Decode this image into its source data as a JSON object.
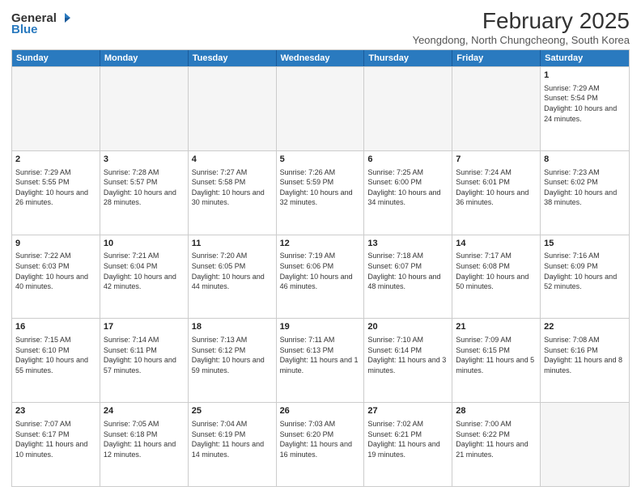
{
  "header": {
    "logo_general": "General",
    "logo_blue": "Blue",
    "month_title": "February 2025",
    "location": "Yeongdong, North Chungcheong, South Korea"
  },
  "days_of_week": [
    "Sunday",
    "Monday",
    "Tuesday",
    "Wednesday",
    "Thursday",
    "Friday",
    "Saturday"
  ],
  "weeks": [
    [
      {
        "day": "",
        "empty": true
      },
      {
        "day": "",
        "empty": true
      },
      {
        "day": "",
        "empty": true
      },
      {
        "day": "",
        "empty": true
      },
      {
        "day": "",
        "empty": true
      },
      {
        "day": "",
        "empty": true
      },
      {
        "day": "1",
        "sunrise": "7:29 AM",
        "sunset": "5:54 PM",
        "daylight": "10 hours and 24 minutes."
      }
    ],
    [
      {
        "day": "2",
        "sunrise": "7:29 AM",
        "sunset": "5:55 PM",
        "daylight": "10 hours and 26 minutes."
      },
      {
        "day": "3",
        "sunrise": "7:28 AM",
        "sunset": "5:57 PM",
        "daylight": "10 hours and 28 minutes."
      },
      {
        "day": "4",
        "sunrise": "7:27 AM",
        "sunset": "5:58 PM",
        "daylight": "10 hours and 30 minutes."
      },
      {
        "day": "5",
        "sunrise": "7:26 AM",
        "sunset": "5:59 PM",
        "daylight": "10 hours and 32 minutes."
      },
      {
        "day": "6",
        "sunrise": "7:25 AM",
        "sunset": "6:00 PM",
        "daylight": "10 hours and 34 minutes."
      },
      {
        "day": "7",
        "sunrise": "7:24 AM",
        "sunset": "6:01 PM",
        "daylight": "10 hours and 36 minutes."
      },
      {
        "day": "8",
        "sunrise": "7:23 AM",
        "sunset": "6:02 PM",
        "daylight": "10 hours and 38 minutes."
      }
    ],
    [
      {
        "day": "9",
        "sunrise": "7:22 AM",
        "sunset": "6:03 PM",
        "daylight": "10 hours and 40 minutes."
      },
      {
        "day": "10",
        "sunrise": "7:21 AM",
        "sunset": "6:04 PM",
        "daylight": "10 hours and 42 minutes."
      },
      {
        "day": "11",
        "sunrise": "7:20 AM",
        "sunset": "6:05 PM",
        "daylight": "10 hours and 44 minutes."
      },
      {
        "day": "12",
        "sunrise": "7:19 AM",
        "sunset": "6:06 PM",
        "daylight": "10 hours and 46 minutes."
      },
      {
        "day": "13",
        "sunrise": "7:18 AM",
        "sunset": "6:07 PM",
        "daylight": "10 hours and 48 minutes."
      },
      {
        "day": "14",
        "sunrise": "7:17 AM",
        "sunset": "6:08 PM",
        "daylight": "10 hours and 50 minutes."
      },
      {
        "day": "15",
        "sunrise": "7:16 AM",
        "sunset": "6:09 PM",
        "daylight": "10 hours and 52 minutes."
      }
    ],
    [
      {
        "day": "16",
        "sunrise": "7:15 AM",
        "sunset": "6:10 PM",
        "daylight": "10 hours and 55 minutes."
      },
      {
        "day": "17",
        "sunrise": "7:14 AM",
        "sunset": "6:11 PM",
        "daylight": "10 hours and 57 minutes."
      },
      {
        "day": "18",
        "sunrise": "7:13 AM",
        "sunset": "6:12 PM",
        "daylight": "10 hours and 59 minutes."
      },
      {
        "day": "19",
        "sunrise": "7:11 AM",
        "sunset": "6:13 PM",
        "daylight": "11 hours and 1 minute."
      },
      {
        "day": "20",
        "sunrise": "7:10 AM",
        "sunset": "6:14 PM",
        "daylight": "11 hours and 3 minutes."
      },
      {
        "day": "21",
        "sunrise": "7:09 AM",
        "sunset": "6:15 PM",
        "daylight": "11 hours and 5 minutes."
      },
      {
        "day": "22",
        "sunrise": "7:08 AM",
        "sunset": "6:16 PM",
        "daylight": "11 hours and 8 minutes."
      }
    ],
    [
      {
        "day": "23",
        "sunrise": "7:07 AM",
        "sunset": "6:17 PM",
        "daylight": "11 hours and 10 minutes."
      },
      {
        "day": "24",
        "sunrise": "7:05 AM",
        "sunset": "6:18 PM",
        "daylight": "11 hours and 12 minutes."
      },
      {
        "day": "25",
        "sunrise": "7:04 AM",
        "sunset": "6:19 PM",
        "daylight": "11 hours and 14 minutes."
      },
      {
        "day": "26",
        "sunrise": "7:03 AM",
        "sunset": "6:20 PM",
        "daylight": "11 hours and 16 minutes."
      },
      {
        "day": "27",
        "sunrise": "7:02 AM",
        "sunset": "6:21 PM",
        "daylight": "11 hours and 19 minutes."
      },
      {
        "day": "28",
        "sunrise": "7:00 AM",
        "sunset": "6:22 PM",
        "daylight": "11 hours and 21 minutes."
      },
      {
        "day": "",
        "empty": true
      }
    ]
  ]
}
